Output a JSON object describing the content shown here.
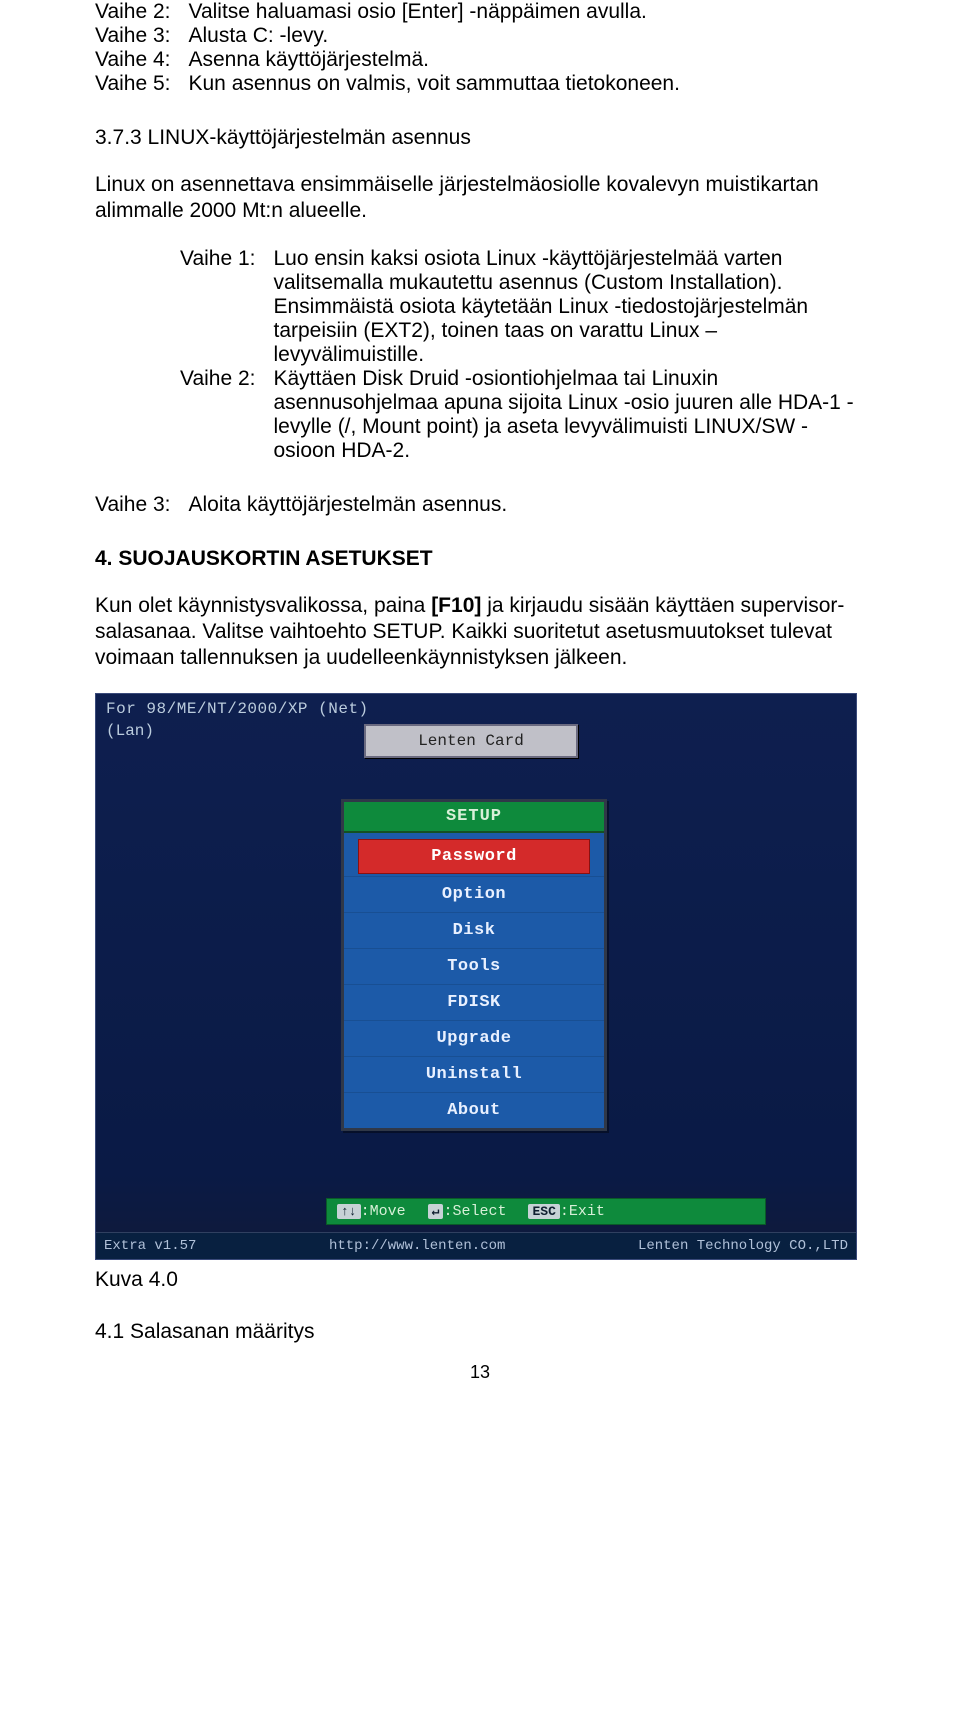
{
  "steps_top": [
    {
      "label": "Vaihe 2:",
      "text": "Valitse haluamasi osio [Enter] -näppäimen avulla."
    },
    {
      "label": "Vaihe 3:",
      "text": "Alusta C: -levy."
    },
    {
      "label": "Vaihe 4:",
      "text": "Asenna käyttöjärjestelmä."
    },
    {
      "label": "Vaihe 5:",
      "text": "Kun asennus on valmis, voit sammuttaa tietokoneen."
    }
  ],
  "section_373": "3.7.3 LINUX-käyttöjärjestelmän asennus",
  "intro_373": "Linux on asennettava ensimmäiselle järjestelmäosiolle kovalevyn muistikartan alimmalle 2000 Mt:n alueelle.",
  "nested_steps": [
    {
      "label": "Vaihe 1:",
      "text": "Luo ensin kaksi osiota Linux -käyttöjärjestelmää varten valitsemalla mukautettu asennus (Custom Installation). Ensimmäistä osiota käytetään Linux -tiedostojärjestelmän tarpeisiin (EXT2), toinen taas on varattu Linux –levyvälimuistille."
    },
    {
      "label": "Vaihe 2:",
      "text": "Käyttäen Disk Druid -osiontiohjelmaa tai Linuxin asennusohjelmaa apuna sijoita Linux -osio juuren alle HDA-1 -levylle (/, Mount point) ja aseta levyvälimuisti LINUX/SW -osioon HDA-2."
    }
  ],
  "outer_step3": {
    "label": "Vaihe 3:",
    "text": "Aloita käyttöjärjestelmän asennus."
  },
  "heading4": "4. SUOJAUSKORTIN ASETUKSET",
  "para4_pre": "Kun olet käynnistysvalikossa, paina ",
  "para4_key": "[F10]",
  "para4_post": " ja kirjaudu sisään käyttäen supervisor-salasanaa. Valitse vaihtoehto SETUP. Kaikki suoritetut asetusmuutokset tulevat voimaan tallennuksen ja uudelleenkäynnistyksen jälkeen.",
  "screenshot": {
    "topline": "For 98/ME/NT/2000/XP (Net)",
    "lan": "(Lan)",
    "titlebar": "Lenten Card",
    "setup_header": "SETUP",
    "menu": [
      "Password",
      "Option",
      "Disk",
      "Tools",
      "FDISK",
      "Upgrade",
      "Uninstall",
      "About"
    ],
    "help": {
      "move_key": "↑↓",
      "move": ":Move",
      "select_key": "↵",
      "select": ":Select",
      "exit_key": "ESC",
      "exit": ":Exit"
    },
    "bottom": {
      "version": "Extra v1.57",
      "url": "http://www.lenten.com",
      "company": "Lenten Technology CO.,LTD"
    }
  },
  "caption": "Kuva 4.0",
  "heading41": "4.1 Salasanan määritys",
  "page_number": "13"
}
